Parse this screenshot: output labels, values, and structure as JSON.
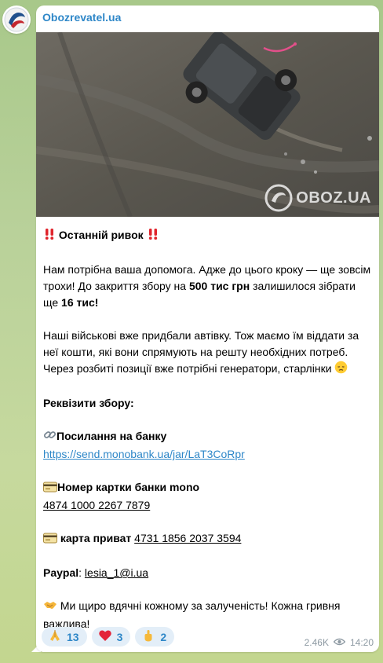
{
  "colors": {
    "accent": "#2e87c8",
    "reaction_bg": "#e3eef8",
    "meta_text": "#8e9aa3"
  },
  "channel": {
    "name": "Obozrevatel.ua",
    "avatar_icon": "obozrevatel-logo-icon"
  },
  "photo": {
    "watermark_text": "OBOZ.UA",
    "watermark_icon": "oboz-logo-icon"
  },
  "message": {
    "title": "Останній ривок",
    "title_icons": [
      "double-exclamation-icon",
      "double-exclamation-icon"
    ],
    "p1_part1": "Нам потрібна ваша допомога. Адже до цього кроку — ще зовсім трохи! До закриття збору на ",
    "p1_bold1": "500 тис грн",
    "p1_part2": " залишилося зібрати ще ",
    "p1_bold2": "16 тис!",
    "p2": "Наші військові вже придбали автівку. Тож маємо їм віддати за неї кошти, які вони спрямують на решту необхідних потреб. Через розбиті позиції вже потрібні генератори, старлінки",
    "p2_icon": "disappointed-face-icon",
    "requisites_title": "Реквізити збору:",
    "bank_link_label": "Посилання на банку",
    "bank_link_icon": "link-icon",
    "bank_link_url": "https://send.monobank.ua/jar/LaT3CoRpr",
    "mono_label": "Номер картки банки mono",
    "mono_icon": "card-icon",
    "mono_number": "4874 1000 2267 7879",
    "privat_label": "карта приват",
    "privat_icon": "card-icon",
    "privat_number": "4731 1856 2037 3594",
    "paypal_label": "Paypal",
    "paypal_sep": ": ",
    "paypal_value": "lesia_1@i.ua",
    "thanks_icon": "handshake-icon",
    "thanks": "Ми щиро вдячні кожному за залученість! Кожна гривня важлива!"
  },
  "reactions": [
    {
      "icon": "folded-hands-icon",
      "count": "13"
    },
    {
      "icon": "red-heart-icon",
      "count": "3"
    },
    {
      "icon": "hand-icon",
      "count": "2"
    }
  ],
  "meta": {
    "views": "2.46K",
    "views_icon": "eye-icon",
    "time": "14:20"
  }
}
